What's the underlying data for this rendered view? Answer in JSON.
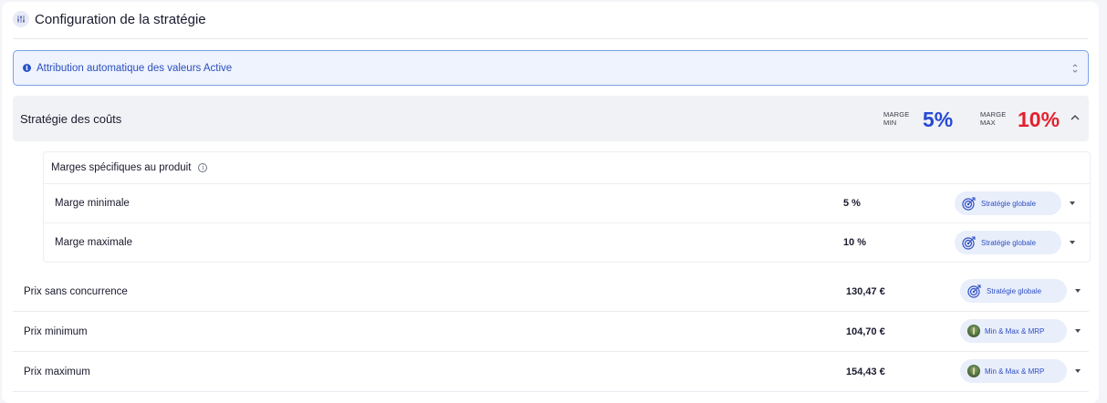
{
  "header": {
    "title": "Configuration de la stratégie",
    "icon": "sliders-icon"
  },
  "select": {
    "label": "Attribution automatique des valeurs Active",
    "icon": "info-icon"
  },
  "strategy": {
    "title": "Stratégie des coûts",
    "margin_min": {
      "label_line1": "MARGE",
      "label_line2": "MIN",
      "value": "5%",
      "color": "#2649d6"
    },
    "margin_max": {
      "label_line1": "MARGE",
      "label_line2": "MAX",
      "value": "10%",
      "color": "#e5202d"
    }
  },
  "specific": {
    "title": "Marges spécifiques au produit",
    "rows": [
      {
        "label": "Marge minimale",
        "value": "5 %",
        "pill": "Stratégie globale",
        "pill_icon": "target-icon"
      },
      {
        "label": "Marge maximale",
        "value": "10 %",
        "pill": "Stratégie globale",
        "pill_icon": "target-icon"
      }
    ]
  },
  "prices": [
    {
      "label": "Prix sans concurrence",
      "value": "130,47 €",
      "pill": "Stratégie globale",
      "pill_icon": "target-icon"
    },
    {
      "label": "Prix minimum",
      "value": "104,70 €",
      "pill": "Min & Max & MRP",
      "pill_icon": "avatar-icon"
    },
    {
      "label": "Prix maximum",
      "value": "154,43 €",
      "pill": "Min & Max & MRP",
      "pill_icon": "avatar-icon"
    }
  ]
}
